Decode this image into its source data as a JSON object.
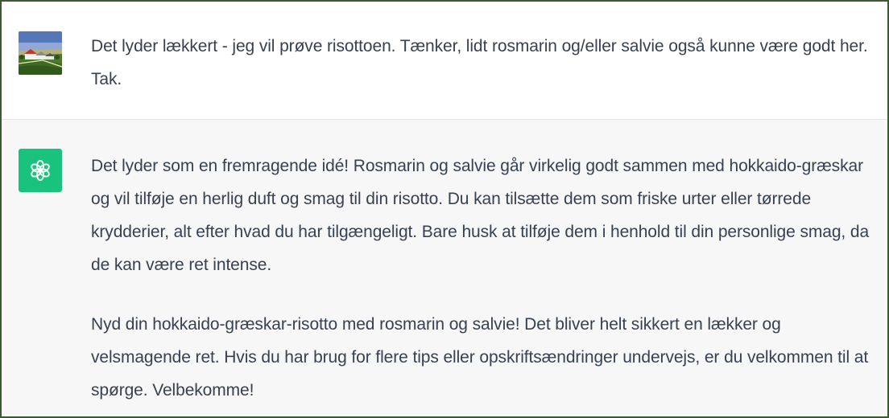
{
  "conversation": {
    "user_message": {
      "avatar_icon": "landscape-photo-avatar",
      "text": "Det lyder lækkert - jeg vil prøve risottoen. Tænker, lidt rosmarin og/eller salvie også kunne være godt her. Tak."
    },
    "assistant_message": {
      "avatar_icon": "openai-logo-icon",
      "avatar_color": "#19c37d",
      "paragraphs": [
        "Det lyder som en fremragende idé! Rosmarin og salvie går virkelig godt sammen med hokkaido-græskar og vil tilføje en herlig duft og smag til din risotto. Du kan tilsætte dem som friske urter eller tørrede krydderier, alt efter hvad du har tilgængeligt. Bare husk at tilføje dem i henhold til din personlige smag, da de kan være ret intense.",
        "Nyd din hokkaido-græskar-risotto med rosmarin og salvie! Det bliver helt sikkert en lækker og velsmagende ret. Hvis du har brug for flere tips eller opskriftsændringer undervejs, er du velkommen til at spørge. Velbekomme!"
      ]
    }
  }
}
